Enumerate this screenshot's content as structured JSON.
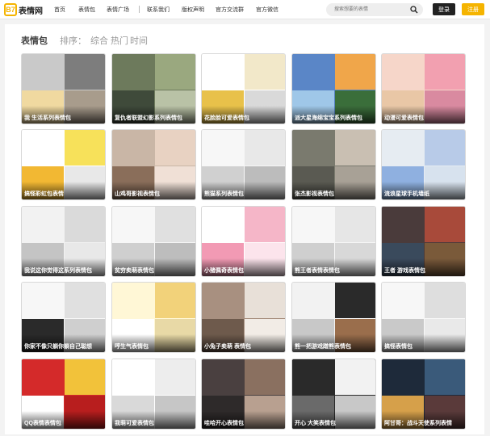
{
  "site": {
    "logo_mark": "B7",
    "name": "表情网"
  },
  "nav": {
    "items": [
      "首页",
      "表情包",
      "表情广场",
      "联系我们",
      "版权声明",
      "官方交流群",
      "官方微信"
    ]
  },
  "search": {
    "placeholder": "搜索想要的表情",
    "icon": "search-icon"
  },
  "auth": {
    "login": "登录",
    "register": "注册"
  },
  "colors": {
    "accent": "#f5b400",
    "header_bg": "#ffffff",
    "page_bg": "#f3f3f3"
  },
  "section": {
    "title": "表情包",
    "sort_label": "排序：",
    "sort_options": [
      "综合",
      "热门",
      "时间"
    ]
  },
  "cards": [
    {
      "label": "我 生活系列表情包"
    },
    {
      "label": "复仇者联盟幻影系列表情包"
    },
    {
      "label": "花脸脸可爱表情包"
    },
    {
      "label": "派大星海绵宝宝系列表情包"
    },
    {
      "label": "动漫可爱表情包"
    },
    {
      "label": "搞怪彩虹包表情"
    },
    {
      "label": "山鸡哥影视表情包"
    },
    {
      "label": "熊猫系列表情包"
    },
    {
      "label": "张杰影视表情包"
    },
    {
      "label": "流浪星球手机墙纸"
    },
    {
      "label": "我说这你觉得这系列表情包"
    },
    {
      "label": "贫穷卖萌表情包"
    },
    {
      "label": "小猪佩奇表情包"
    },
    {
      "label": "熊王者表情表情包"
    },
    {
      "label": "王者 游戏表情包"
    },
    {
      "label": "你家不像只躺你躺自己聪想"
    },
    {
      "label": "哼生气表情包"
    },
    {
      "label": "小兔子卖萌 表情包"
    },
    {
      "label": "熊一把游戏蹭熊表情包"
    },
    {
      "label": "搞怪表情包"
    },
    {
      "label": "QQ表情表情包"
    },
    {
      "label": "我萌可爱表情包"
    },
    {
      "label": "哇哈开心表情包"
    },
    {
      "label": "开心 大笑表情包"
    },
    {
      "label": "阿甘哥：战斗天使系列表情"
    }
  ]
}
